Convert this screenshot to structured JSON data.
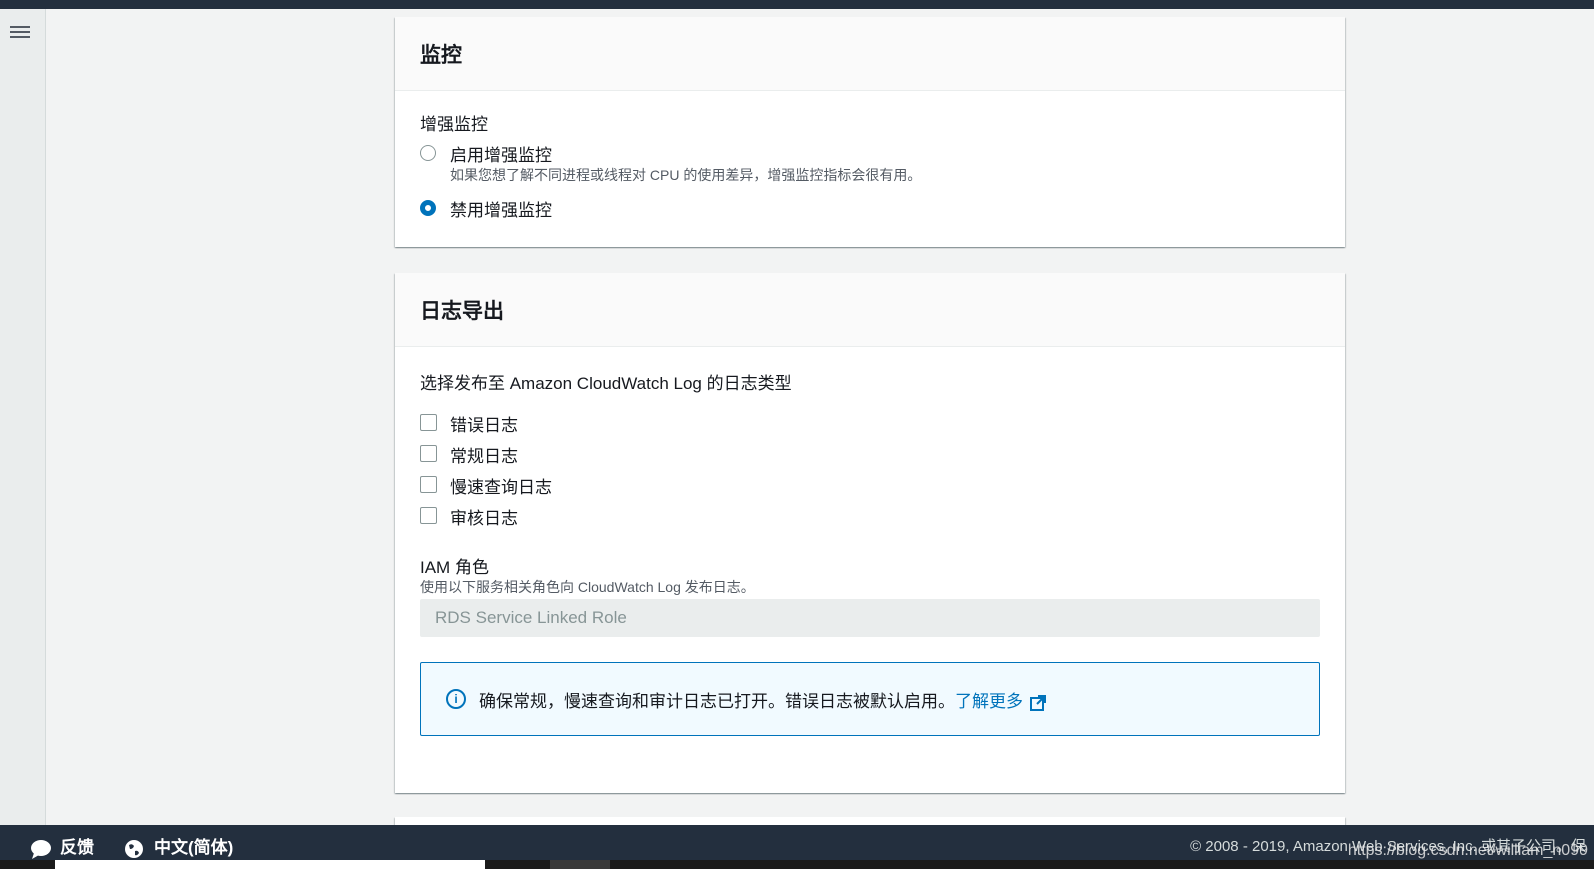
{
  "monitoring": {
    "title": "监控",
    "enhanced_label": "增强监控",
    "options": [
      {
        "label": "启用增强监控",
        "description": "如果您想了解不同进程或线程对 CPU 的使用差异，增强监控指标会很有用。",
        "selected": false
      },
      {
        "label": "禁用增强监控",
        "selected": true
      }
    ]
  },
  "log_export": {
    "title": "日志导出",
    "description": "选择发布至 Amazon CloudWatch Log 的日志类型",
    "log_types": [
      {
        "label": "错误日志",
        "checked": false
      },
      {
        "label": "常规日志",
        "checked": false
      },
      {
        "label": "慢速查询日志",
        "checked": false
      },
      {
        "label": "审核日志",
        "checked": false
      }
    ],
    "iam_role": {
      "label": "IAM 角色",
      "description": "使用以下服务相关角色向 CloudWatch Log 发布日志。",
      "value": "RDS Service Linked Role"
    },
    "info": {
      "text": "确保常规，慢速查询和审计日志已打开。错误日志被默认启用。",
      "link": "了解更多"
    }
  },
  "footer": {
    "feedback": "反馈",
    "language": "中文(简体)",
    "copyright": "© 2008 - 2019, Amazon Web Services, Inc. 或其子公司。保",
    "watermark": "https://blog.csdn.net/william_n099"
  }
}
